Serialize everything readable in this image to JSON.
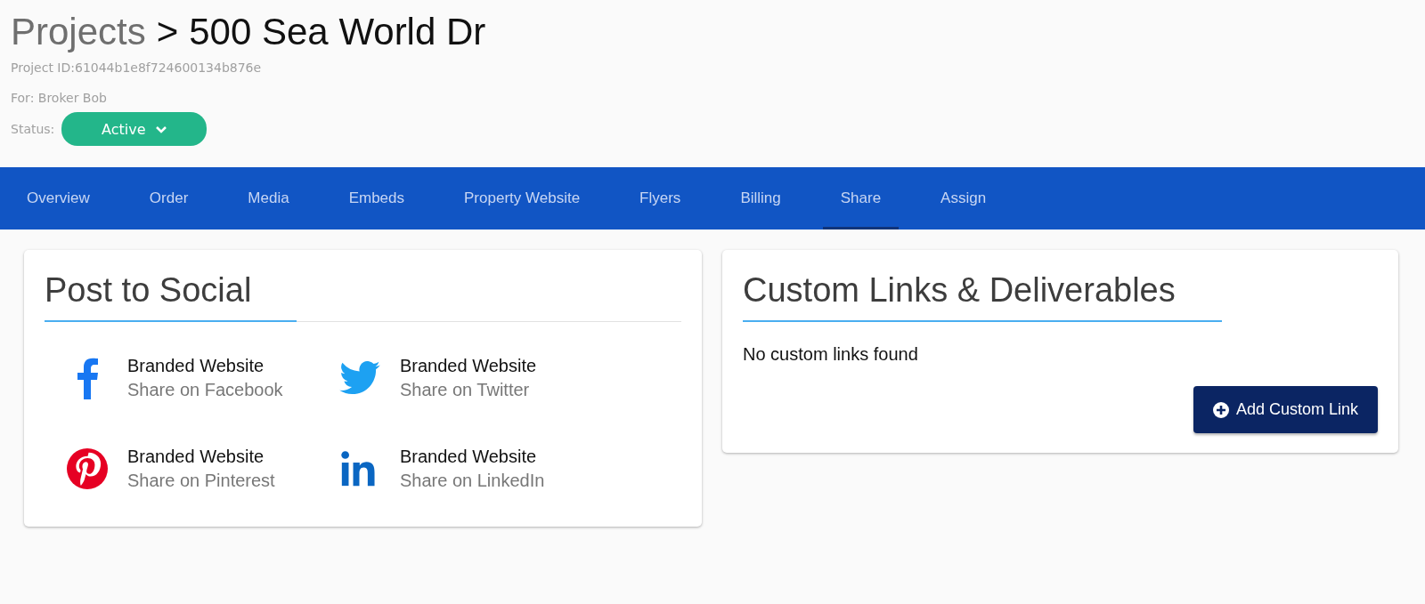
{
  "header": {
    "breadcrumb_parent": "Projects",
    "separator": ">",
    "title": "500 Sea World Dr",
    "project_id": "Project ID:61044b1e8f724600134b876e",
    "for": "For: Broker Bob",
    "status_label": "Status:",
    "status": "Active"
  },
  "tabs": [
    {
      "label": "Overview",
      "selected": false
    },
    {
      "label": "Order",
      "selected": false
    },
    {
      "label": "Media",
      "selected": false
    },
    {
      "label": "Embeds",
      "selected": false
    },
    {
      "label": "Property Website",
      "selected": false
    },
    {
      "label": "Flyers",
      "selected": false
    },
    {
      "label": "Billing",
      "selected": false
    },
    {
      "label": "Share",
      "selected": true
    },
    {
      "label": "Assign",
      "selected": false
    }
  ],
  "social_card": {
    "title": "Post to Social",
    "items": [
      {
        "kind": "facebook",
        "title": "Branded Website",
        "action": "Share on Facebook"
      },
      {
        "kind": "twitter",
        "title": "Branded Website",
        "action": "Share on Twitter"
      },
      {
        "kind": "pinterest",
        "title": "Branded Website",
        "action": "Share on Pinterest"
      },
      {
        "kind": "linkedin",
        "title": "Branded Website",
        "action": "Share on LinkedIn"
      }
    ]
  },
  "links_card": {
    "title": "Custom Links & Deliverables",
    "empty_message": "No custom links found",
    "button": "Add Custom Link"
  }
}
